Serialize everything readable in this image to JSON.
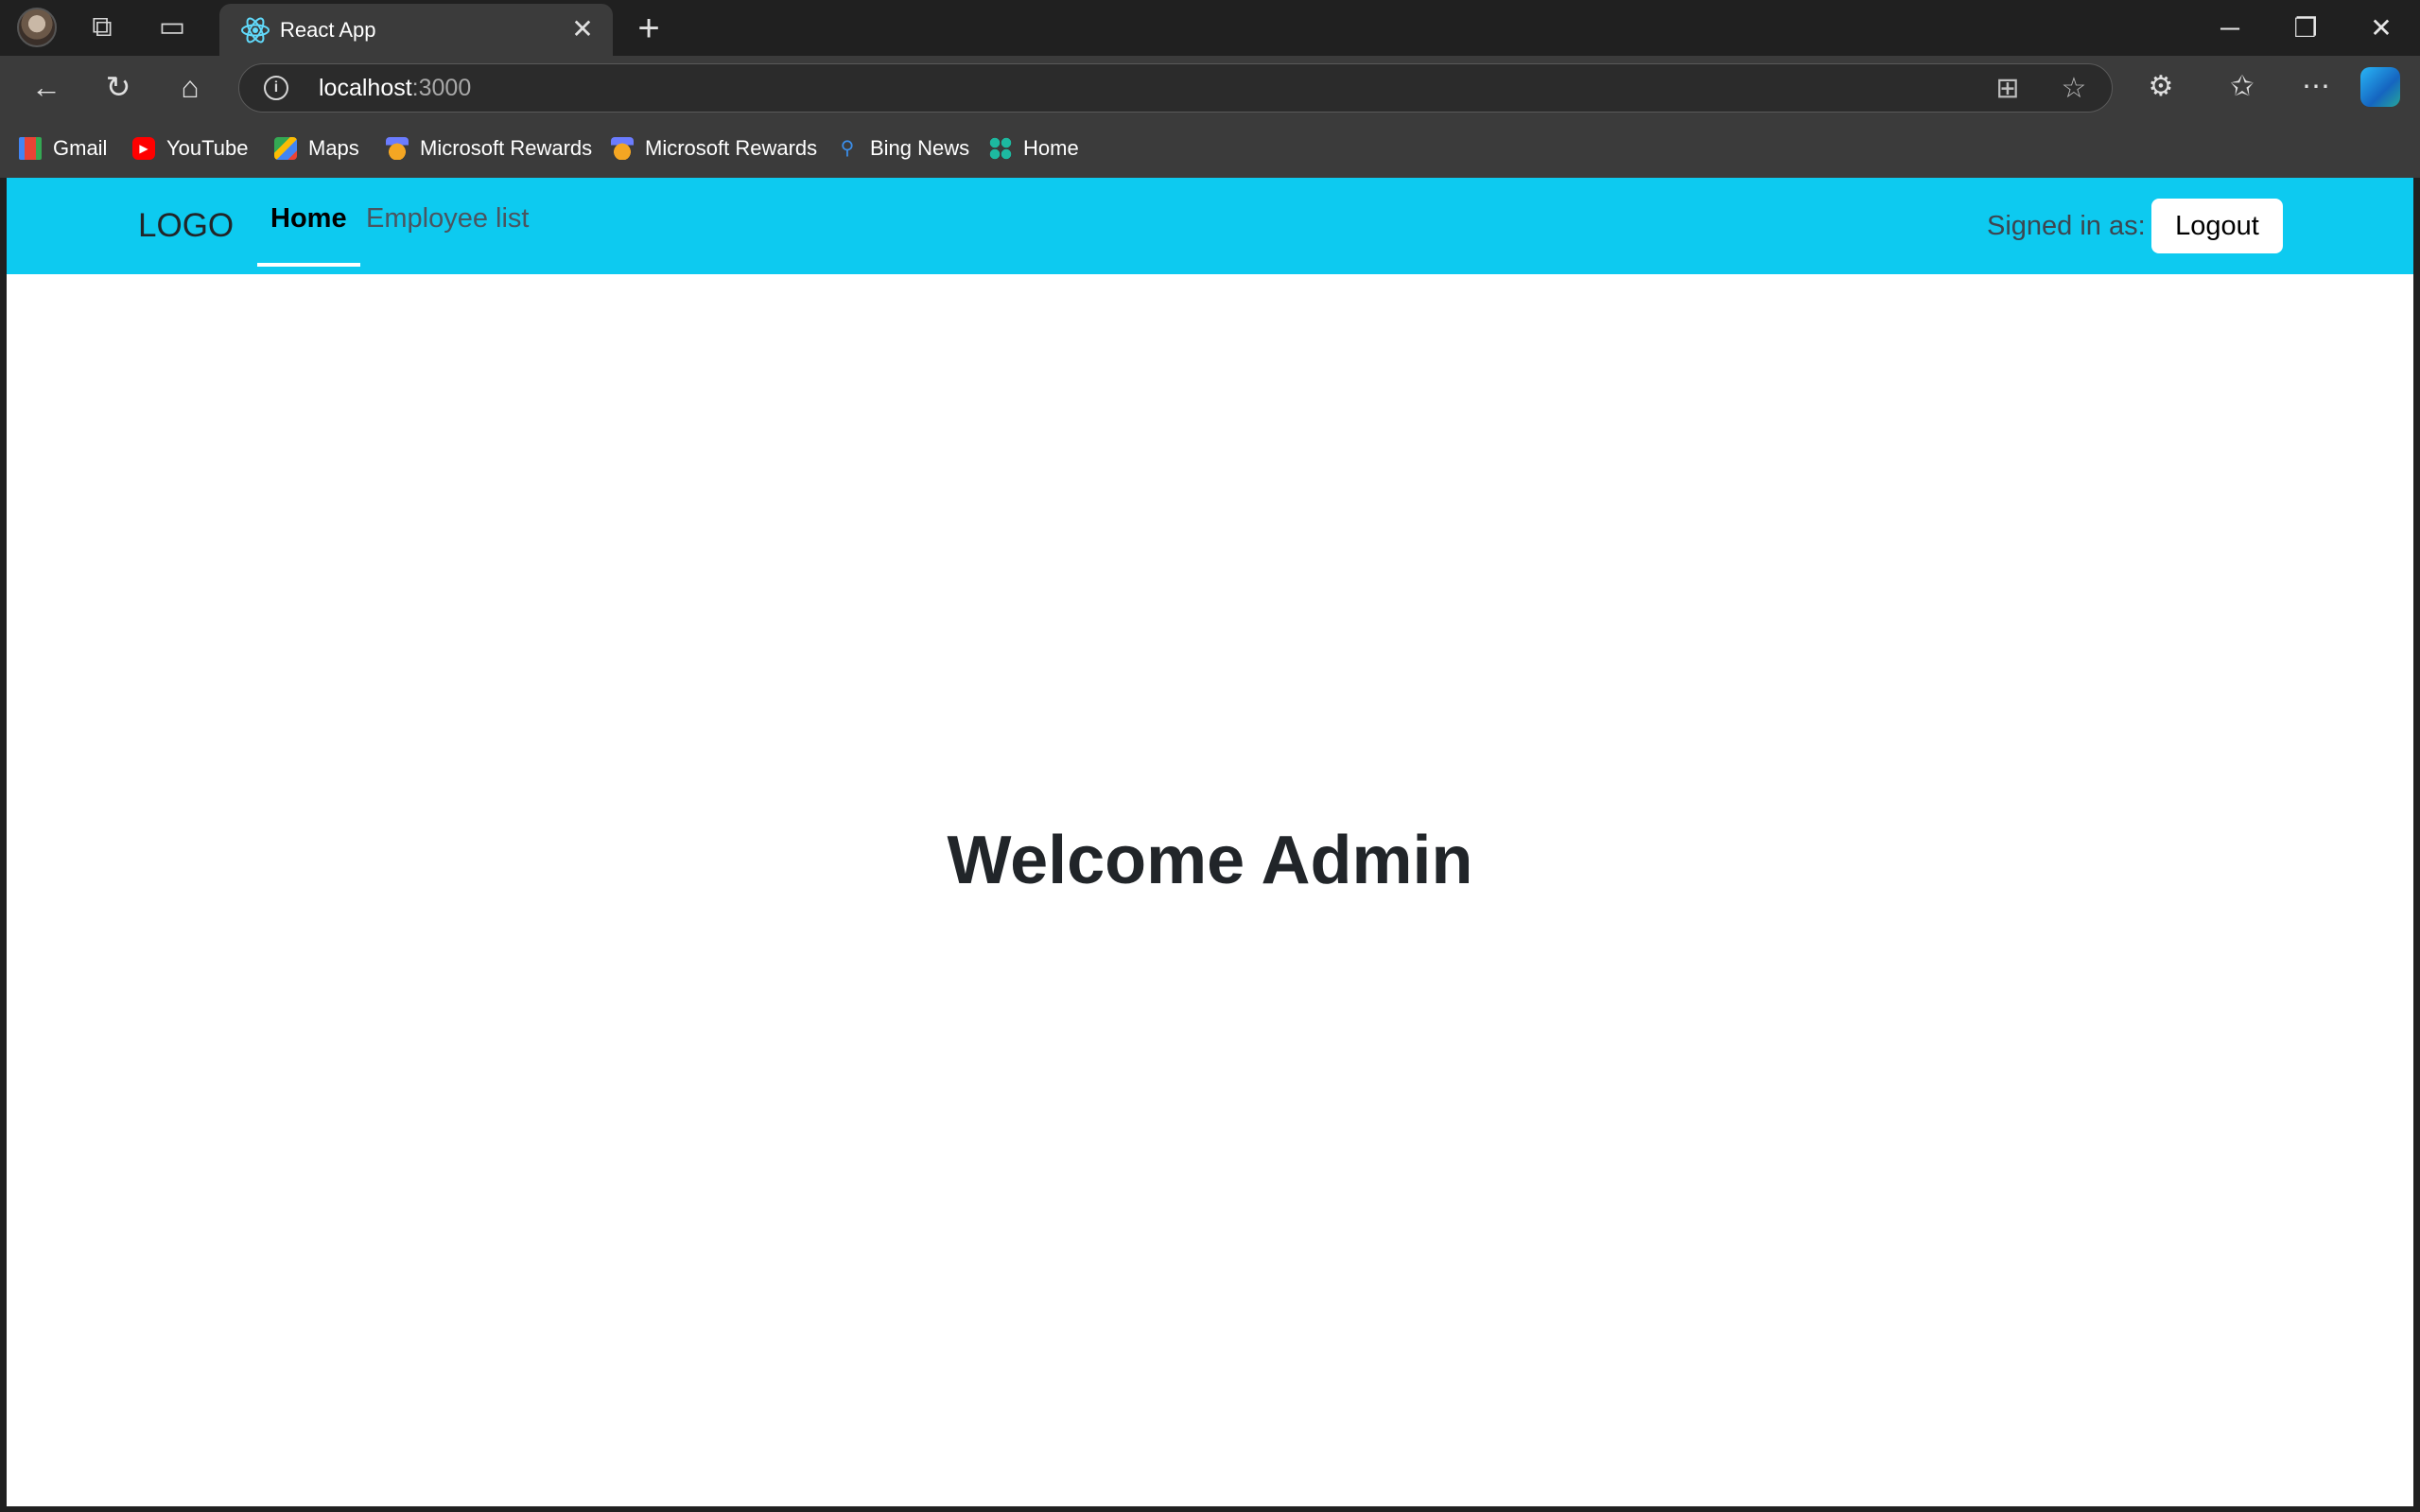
{
  "browser": {
    "tab_title": "React App",
    "address": {
      "host": "localhost",
      "port": ":3000"
    },
    "favorites": [
      {
        "label": "Gmail",
        "icon": "gmail-icon"
      },
      {
        "label": "YouTube",
        "icon": "youtube-icon"
      },
      {
        "label": "Maps",
        "icon": "maps-icon"
      },
      {
        "label": "Microsoft Rewards",
        "icon": "rewards-icon"
      },
      {
        "label": "Microsoft Rewards",
        "icon": "rewards-icon"
      },
      {
        "label": "Bing News",
        "icon": "search-icon"
      },
      {
        "label": "Home",
        "icon": "apps-icon"
      }
    ]
  },
  "app": {
    "logo": "LOGO",
    "nav": {
      "home": "Home",
      "employees": "Employee list"
    },
    "signed_in_label": "Signed in as:",
    "logout_label": "Logout",
    "welcome": "Welcome Admin",
    "colors": {
      "navbar": "#0dcaf0",
      "text": "#212529"
    }
  }
}
